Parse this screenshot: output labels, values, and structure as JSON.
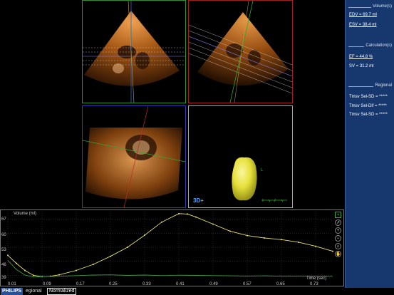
{
  "panels": {
    "render_badge": "3D+"
  },
  "sidebar": {
    "volume_heading": "Volume(s)",
    "edv": "EDV = 69.7 ml",
    "esv": "ESV = 38.4 ml",
    "calc_heading": "Calculation(s)",
    "ef": "EF = 44.8 %",
    "sv": "SV = 31.2 ml",
    "regional_heading": "Regional",
    "regional_items": [
      "Tmsv Sel-SD = *****",
      "Tmsv Sel-Dif = *****",
      "Tmsv Sel-SD = *****"
    ]
  },
  "graph": {
    "title": "Volume (ml)",
    "time_label": "Time (sec)",
    "y_ticks": [
      "67",
      "60",
      "53",
      "46",
      "39"
    ],
    "x_ticks": [
      "0.01",
      "0.09",
      "0.17",
      "0.25",
      "0.33",
      "0.41",
      "0.49",
      "0.57",
      "0.65",
      "0.73"
    ],
    "tools": [
      "+",
      "↗",
      "+",
      "−",
      "⌂",
      "✋"
    ]
  },
  "footer": {
    "brand": "PHILIPS",
    "tab_regional": "egional",
    "tab_normalized": "Normalized"
  },
  "colors": {
    "sidebar_bg": "#17386e",
    "volume_curve": "#e8e070",
    "secondary_curve": "#3a9a3a",
    "mesh": "#e6e03a"
  },
  "chart_data": {
    "type": "line",
    "title": "",
    "xlabel": "Time (sec)",
    "ylabel": "Volume (ml)",
    "ylim": [
      36,
      70
    ],
    "xlim": [
      0.01,
      0.77
    ],
    "series": [
      {
        "name": "",
        "x": [
          0.01,
          0.03,
          0.05,
          0.07,
          0.09,
          0.11,
          0.13,
          0.17,
          0.21,
          0.25,
          0.29,
          0.33,
          0.37,
          0.41,
          0.43,
          0.45,
          0.49,
          0.53,
          0.57,
          0.61,
          0.65,
          0.69,
          0.73,
          0.77
        ],
        "values": [
          49,
          45,
          41.5,
          39,
          38.4,
          38.6,
          39.3,
          41.5,
          44.5,
          48.5,
          53,
          59,
          65.5,
          69.7,
          69.5,
          68,
          64.5,
          61,
          58.8,
          57.6,
          56.8,
          55.5,
          53.5,
          51
        ]
      },
      {
        "name": "",
        "x": [
          0.01,
          0.03,
          0.05,
          0.07,
          0.09,
          0.13,
          0.17,
          0.21,
          0.25,
          0.29,
          0.33,
          0.37,
          0.41,
          0.45,
          0.49,
          0.53,
          0.57,
          0.61,
          0.65,
          0.69,
          0.73,
          0.77
        ],
        "values": [
          46.5,
          42,
          39.2,
          38.2,
          38.4,
          38.6,
          38.9,
          39.2,
          39.3,
          39.0,
          39.2,
          38.9,
          39.1,
          39.0,
          38.9,
          38.8,
          38.7,
          38.8,
          38.6,
          38.6,
          38.7,
          38.5
        ]
      }
    ]
  }
}
